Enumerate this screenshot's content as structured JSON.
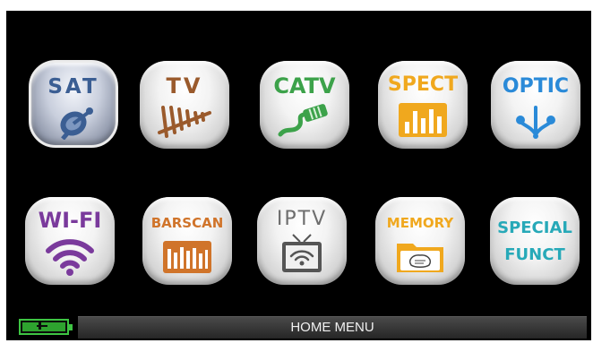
{
  "menu": {
    "row1": [
      {
        "key": "sat",
        "label": "SAT",
        "icon": "satellite-dish-icon",
        "color": "#3b5e93",
        "selected": true
      },
      {
        "key": "tv",
        "label": "TV",
        "icon": "tv-antenna-icon",
        "color": "#9a5a2c"
      },
      {
        "key": "catv",
        "label": "CATV",
        "icon": "coax-cable-icon",
        "color": "#3ca24a"
      },
      {
        "key": "spect",
        "label": "SPECT",
        "icon": "spectrum-icon",
        "color": "#f0a81e"
      },
      {
        "key": "optic",
        "label": "OPTIC",
        "icon": "optic-fiber-icon",
        "color": "#2a8ad8"
      }
    ],
    "row2": [
      {
        "key": "wifi",
        "label": "WI-FI",
        "icon": "wifi-icon",
        "color": "#7a3a9c"
      },
      {
        "key": "barscan",
        "label": "BARSCAN",
        "icon": "barscan-icon",
        "color": "#d0742a"
      },
      {
        "key": "iptv",
        "label": "IPTV",
        "icon": "iptv-icon",
        "color": "#6e6e6e"
      },
      {
        "key": "memory",
        "label": "MEMORY",
        "icon": "memory-folder-icon",
        "color": "#f0a81e"
      },
      {
        "key": "special",
        "label_line1": "SPECIAL",
        "label_line2": "FUNCT",
        "color": "#27a9b8"
      }
    ]
  },
  "status_bar": {
    "title": "HOME MENU",
    "battery_icon": "battery-charging-icon",
    "battery_level": 1.0,
    "battery_color": "#3ec443"
  }
}
